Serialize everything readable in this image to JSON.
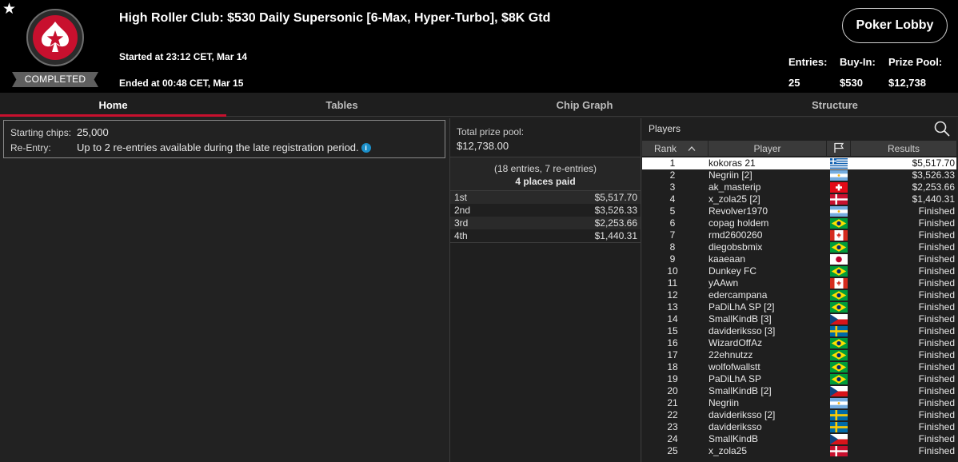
{
  "header": {
    "status": "COMPLETED",
    "title": "High Roller Club: $530 Daily Supersonic [6-Max, Hyper-Turbo], $8K Gtd",
    "started": "Started at 23:12 CET, Mar 14",
    "ended": "Ended at 00:48 CET, Mar 15",
    "lobby_button": "Poker Lobby",
    "entries_label": "Entries:",
    "entries_value": "25",
    "buyin_label": "Buy-In:",
    "buyin_value": "$530",
    "prizepool_label": "Prize Pool:",
    "prizepool_value": "$12,738",
    "brand_color": "#c8102e"
  },
  "tabs": [
    "Home",
    "Tables",
    "Chip Graph",
    "Structure"
  ],
  "home": {
    "starting_chips_label": "Starting chips:",
    "starting_chips_value": "25,000",
    "reentry_label": "Re-Entry:",
    "reentry_value": "Up to 2 re-entries available during the late registration period.",
    "info_icon": "i"
  },
  "prize": {
    "total_label": "Total prize pool:",
    "total_value": "$12,738.00",
    "entries_line": "(18 entries, 7 re-entries)",
    "places_line": "4 places paid",
    "payouts": [
      {
        "place": "1st",
        "amount": "$5,517.70"
      },
      {
        "place": "2nd",
        "amount": "$3,526.33"
      },
      {
        "place": "3rd",
        "amount": "$2,253.66"
      },
      {
        "place": "4th",
        "amount": "$1,440.31"
      }
    ]
  },
  "players": {
    "title": "Players",
    "columns": {
      "rank": "Rank",
      "player": "Player",
      "results": "Results"
    },
    "rows": [
      {
        "rank": "1",
        "name": "kokoras 21",
        "flag": "gr",
        "result": "$5,517.70"
      },
      {
        "rank": "2",
        "name": "Negriin [2]",
        "flag": "ar",
        "result": "$3,526.33"
      },
      {
        "rank": "3",
        "name": "ak_masterip",
        "flag": "ch",
        "result": "$2,253.66"
      },
      {
        "rank": "4",
        "name": "x_zola25 [2]",
        "flag": "dk",
        "result": "$1,440.31"
      },
      {
        "rank": "5",
        "name": "Revolver1970",
        "flag": "ar",
        "result": "Finished"
      },
      {
        "rank": "6",
        "name": "copag holdem",
        "flag": "br",
        "result": "Finished"
      },
      {
        "rank": "7",
        "name": "rmd2600260",
        "flag": "ca",
        "result": "Finished"
      },
      {
        "rank": "8",
        "name": "diegobsbmix",
        "flag": "br",
        "result": "Finished"
      },
      {
        "rank": "9",
        "name": "kaaeaan",
        "flag": "jp",
        "result": "Finished"
      },
      {
        "rank": "10",
        "name": "Dunkey FC",
        "flag": "br",
        "result": "Finished"
      },
      {
        "rank": "11",
        "name": "yAAwn",
        "flag": "ca",
        "result": "Finished"
      },
      {
        "rank": "12",
        "name": "edercampana",
        "flag": "br",
        "result": "Finished"
      },
      {
        "rank": "13",
        "name": "PaDiLhA SP [2]",
        "flag": "br",
        "result": "Finished"
      },
      {
        "rank": "14",
        "name": "SmallKindB [3]",
        "flag": "cz",
        "result": "Finished"
      },
      {
        "rank": "15",
        "name": "davideriksso [3]",
        "flag": "se",
        "result": "Finished"
      },
      {
        "rank": "16",
        "name": "WizardOffAz",
        "flag": "br",
        "result": "Finished"
      },
      {
        "rank": "17",
        "name": "22ehnutzz",
        "flag": "br",
        "result": "Finished"
      },
      {
        "rank": "18",
        "name": "wolfofwallstt",
        "flag": "br",
        "result": "Finished"
      },
      {
        "rank": "19",
        "name": "PaDiLhA SP",
        "flag": "br",
        "result": "Finished"
      },
      {
        "rank": "20",
        "name": "SmallKindB [2]",
        "flag": "cz",
        "result": "Finished"
      },
      {
        "rank": "21",
        "name": "Negriin",
        "flag": "ar",
        "result": "Finished"
      },
      {
        "rank": "22",
        "name": "davideriksso [2]",
        "flag": "se",
        "result": "Finished"
      },
      {
        "rank": "23",
        "name": "davideriksso",
        "flag": "se",
        "result": "Finished"
      },
      {
        "rank": "24",
        "name": "SmallKindB",
        "flag": "cz",
        "result": "Finished"
      },
      {
        "rank": "25",
        "name": "x_zola25",
        "flag": "dk",
        "result": "Finished"
      }
    ]
  }
}
